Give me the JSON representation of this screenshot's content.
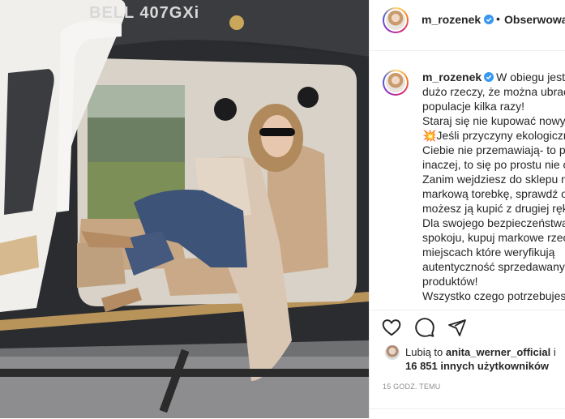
{
  "post": {
    "username": "m_rozenek",
    "follow_label": "Obserwowan",
    "separator": "•",
    "verified_icon": "verified-badge-icon",
    "helicopter_text": "BELL 407GXi"
  },
  "caption": {
    "username": "m_rozenek",
    "lines": [
      "W obiegu jest",
      "dużo rzeczy, że można ubrać",
      "populacje kilka razy!",
      "Staraj się nie kupować nowyc",
      "💥Jeśli przyczyny ekologiczne",
      "Ciebie nie przemawiają- to p",
      "inaczej, to się po prostu nie o",
      "Zanim wejdziesz do sklepu n",
      "markową torebkę, sprawdź o",
      "możesz ją kupić z drugiej ręk",
      "Dla swojego bezpieczeństwa",
      "spokoju, kupuj markowe rzec",
      "miejscach które weryfikują",
      "autentyczność sprzedawanych",
      "produktów!",
      "Wszystko czego potrzebujesz"
    ]
  },
  "actions": {
    "like_icon": "heart-icon",
    "comment_icon": "comment-icon",
    "share_icon": "share-icon"
  },
  "likes": {
    "prefix": "Lubią to",
    "user": "anita_werner_official",
    "joiner": "i",
    "count": "16 851 innych użytkowników"
  },
  "timestamp": "15 GODZ. TEMU",
  "colors": {
    "verified": "#3897f0",
    "border": "#efefef",
    "muted": "#8e8e8e"
  }
}
